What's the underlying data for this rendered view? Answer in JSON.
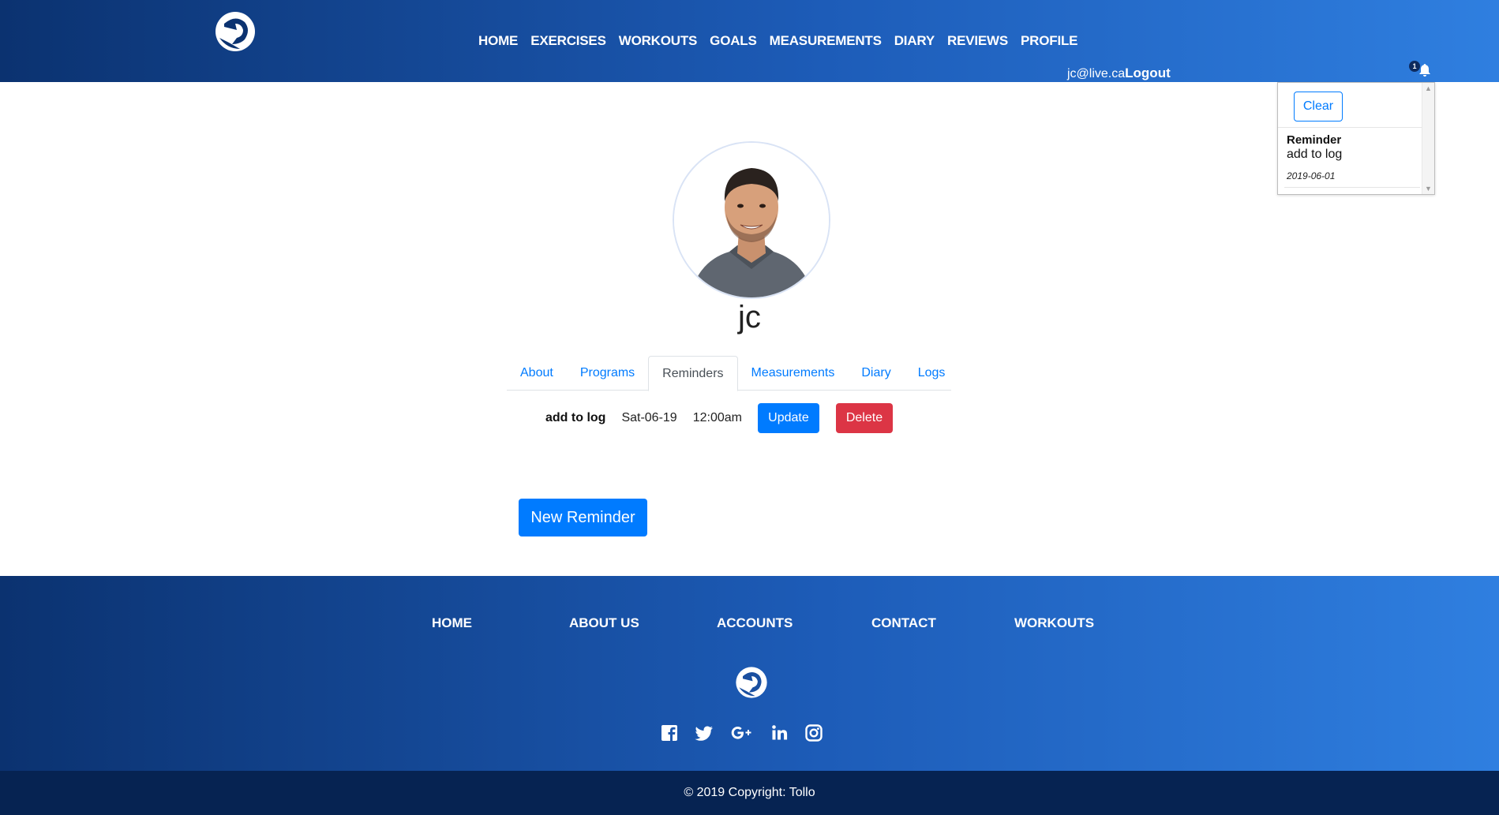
{
  "header": {
    "nav": [
      "HOME",
      "EXERCISES",
      "WORKOUTS",
      "GOALS",
      "MEASUREMENTS",
      "DIARY",
      "REVIEWS",
      "PROFILE"
    ],
    "user_email": "jc@live.ca",
    "logout_label": "Logout",
    "notification_count": "1"
  },
  "notifications": {
    "clear_label": "Clear",
    "items": [
      {
        "title": "Reminder",
        "body": "add to log",
        "date": "2019-06-01"
      }
    ]
  },
  "profile": {
    "username": "jc",
    "tabs": [
      "About",
      "Programs",
      "Reminders",
      "Measurements",
      "Diary",
      "Logs"
    ],
    "active_tab": "Reminders"
  },
  "reminders": [
    {
      "text": "add to log",
      "date": "Sat-06-19",
      "time": "12:00am",
      "update_label": "Update",
      "delete_label": "Delete"
    }
  ],
  "new_reminder_label": "New Reminder",
  "footer": {
    "nav": [
      "HOME",
      "ABOUT US",
      "ACCOUNTS",
      "CONTACT",
      "WORKOUTS"
    ],
    "social_icons": [
      "facebook-icon",
      "twitter-icon",
      "google-plus-icon",
      "linkedin-icon",
      "instagram-icon"
    ],
    "copyright": "© 2019 Copyright: Tollo"
  },
  "colors": {
    "primary": "#007bff",
    "danger": "#dc3545",
    "header_start": "#0b3270",
    "header_end": "#2f7fe0",
    "copyright_bg": "#062352"
  }
}
